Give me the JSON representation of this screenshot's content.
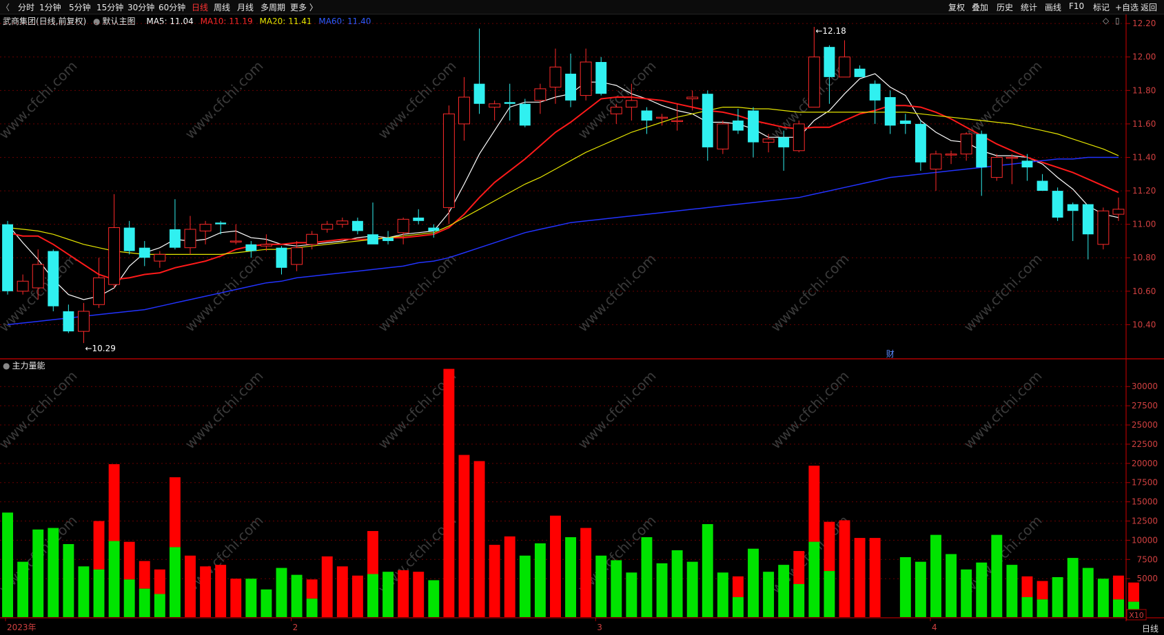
{
  "toolbar": {
    "back_glyph": "〈",
    "periods": [
      "分时",
      "1分钟",
      "5分钟",
      "15分钟",
      "30分钟",
      "60分钟",
      "日线",
      "周线",
      "月线",
      "多周期",
      "更多 〉"
    ],
    "active_period": "日线",
    "right_items": [
      "复权",
      "叠加",
      "历史",
      "统计",
      "画线",
      "F10",
      "标记",
      "+自选",
      "返回"
    ]
  },
  "header": {
    "stock": "武商集团(日线,前复权)",
    "main_chart": "默认主图",
    "ma5": "MA5: 11.04",
    "ma10": "MA10: 11.19",
    "ma20": "MA20: 11.41",
    "ma60": "MA60: 11.40"
  },
  "volume_panel": {
    "title": "主力量能",
    "multiplier": "X10"
  },
  "annotations": {
    "high_label": "12.18",
    "low_label": "10.29",
    "event_marker": "财"
  },
  "x_axis": {
    "labels": [
      "2023年",
      "2",
      "3",
      "4"
    ]
  },
  "period_label": "日线",
  "watermark": "www.cfchi.com",
  "colors": {
    "up": "#ff2a2a",
    "down": "#30f0f0",
    "vol_up": "#ff0000",
    "vol_down": "#00e400",
    "ma5": "#ffffff",
    "ma10": "#ff1a1a",
    "ma20": "#e6e600",
    "ma60": "#2233ff"
  },
  "chart_data": [
    {
      "type": "candlestick",
      "title": "武商集团(日线,前复权)",
      "y_ticks": [
        10.4,
        10.6,
        10.8,
        11.0,
        11.2,
        11.4,
        11.6,
        11.8,
        12.0,
        12.2
      ],
      "ylim": [
        10.2,
        12.25
      ],
      "candles": [
        {
          "o": 11.0,
          "h": 11.02,
          "l": 10.58,
          "c": 10.6
        },
        {
          "o": 10.6,
          "h": 10.7,
          "l": 10.58,
          "c": 10.66
        },
        {
          "o": 10.62,
          "h": 10.85,
          "l": 10.55,
          "c": 10.76
        },
        {
          "o": 10.84,
          "h": 10.85,
          "l": 10.48,
          "c": 10.51
        },
        {
          "o": 10.48,
          "h": 10.52,
          "l": 10.35,
          "c": 10.36
        },
        {
          "o": 10.36,
          "h": 10.53,
          "l": 10.29,
          "c": 10.48
        },
        {
          "o": 10.52,
          "h": 10.8,
          "l": 10.5,
          "c": 10.68
        },
        {
          "o": 10.64,
          "h": 11.18,
          "l": 10.62,
          "c": 10.98
        },
        {
          "o": 10.98,
          "h": 11.02,
          "l": 10.82,
          "c": 10.84
        },
        {
          "o": 10.86,
          "h": 10.9,
          "l": 10.75,
          "c": 10.8
        },
        {
          "o": 10.78,
          "h": 10.84,
          "l": 10.74,
          "c": 10.82
        },
        {
          "o": 10.97,
          "h": 11.15,
          "l": 10.85,
          "c": 10.86
        },
        {
          "o": 10.86,
          "h": 11.05,
          "l": 10.82,
          "c": 10.97
        },
        {
          "o": 10.96,
          "h": 11.02,
          "l": 10.88,
          "c": 11.0
        },
        {
          "o": 11.01,
          "h": 11.02,
          "l": 10.94,
          "c": 11.0
        },
        {
          "o": 10.9,
          "h": 11.0,
          "l": 10.88,
          "c": 10.9
        },
        {
          "o": 10.88,
          "h": 10.9,
          "l": 10.8,
          "c": 10.84
        },
        {
          "o": 10.87,
          "h": 10.94,
          "l": 10.84,
          "c": 10.88
        },
        {
          "o": 10.86,
          "h": 10.87,
          "l": 10.7,
          "c": 10.74
        },
        {
          "o": 10.76,
          "h": 10.9,
          "l": 10.72,
          "c": 10.86
        },
        {
          "o": 10.88,
          "h": 10.96,
          "l": 10.85,
          "c": 10.94
        },
        {
          "o": 10.97,
          "h": 11.02,
          "l": 10.95,
          "c": 11.0
        },
        {
          "o": 11.0,
          "h": 11.04,
          "l": 10.98,
          "c": 11.02
        },
        {
          "o": 11.02,
          "h": 11.04,
          "l": 10.94,
          "c": 10.96
        },
        {
          "o": 10.94,
          "h": 11.13,
          "l": 10.9,
          "c": 10.88
        },
        {
          "o": 10.92,
          "h": 10.96,
          "l": 10.88,
          "c": 10.9
        },
        {
          "o": 10.95,
          "h": 11.04,
          "l": 10.88,
          "c": 11.03
        },
        {
          "o": 11.04,
          "h": 11.09,
          "l": 11.0,
          "c": 11.02
        },
        {
          "o": 10.98,
          "h": 11.0,
          "l": 10.92,
          "c": 10.96
        },
        {
          "o": 11.1,
          "h": 11.71,
          "l": 11.0,
          "c": 11.66
        },
        {
          "o": 11.6,
          "h": 11.88,
          "l": 11.5,
          "c": 11.76
        },
        {
          "o": 11.84,
          "h": 12.17,
          "l": 11.66,
          "c": 11.72
        },
        {
          "o": 11.7,
          "h": 11.74,
          "l": 11.62,
          "c": 11.72
        },
        {
          "o": 11.73,
          "h": 11.84,
          "l": 11.62,
          "c": 11.72
        },
        {
          "o": 11.72,
          "h": 11.75,
          "l": 11.58,
          "c": 11.59
        },
        {
          "o": 11.74,
          "h": 11.84,
          "l": 11.66,
          "c": 11.81
        },
        {
          "o": 11.82,
          "h": 12.05,
          "l": 11.72,
          "c": 11.94
        },
        {
          "o": 11.9,
          "h": 12.02,
          "l": 11.7,
          "c": 11.74
        },
        {
          "o": 11.77,
          "h": 12.05,
          "l": 11.74,
          "c": 11.97
        },
        {
          "o": 11.97,
          "h": 12.0,
          "l": 11.77,
          "c": 11.78
        },
        {
          "o": 11.66,
          "h": 11.72,
          "l": 11.6,
          "c": 11.7
        },
        {
          "o": 11.7,
          "h": 11.84,
          "l": 11.62,
          "c": 11.74
        },
        {
          "o": 11.68,
          "h": 11.7,
          "l": 11.54,
          "c": 11.62
        },
        {
          "o": 11.64,
          "h": 11.66,
          "l": 11.59,
          "c": 11.64
        },
        {
          "o": 11.62,
          "h": 11.72,
          "l": 11.56,
          "c": 11.62
        },
        {
          "o": 11.75,
          "h": 11.8,
          "l": 11.68,
          "c": 11.76
        },
        {
          "o": 11.78,
          "h": 11.8,
          "l": 11.38,
          "c": 11.46
        },
        {
          "o": 11.45,
          "h": 11.62,
          "l": 11.42,
          "c": 11.6
        },
        {
          "o": 11.62,
          "h": 11.69,
          "l": 11.54,
          "c": 11.56
        },
        {
          "o": 11.68,
          "h": 11.7,
          "l": 11.4,
          "c": 11.49
        },
        {
          "o": 11.49,
          "h": 11.54,
          "l": 11.43,
          "c": 11.51
        },
        {
          "o": 11.52,
          "h": 11.56,
          "l": 11.32,
          "c": 11.46
        },
        {
          "o": 11.44,
          "h": 11.62,
          "l": 11.43,
          "c": 11.6
        },
        {
          "o": 11.7,
          "h": 12.18,
          "l": 11.7,
          "c": 12.0
        },
        {
          "o": 12.06,
          "h": 12.07,
          "l": 11.72,
          "c": 11.88
        },
        {
          "o": 11.88,
          "h": 12.1,
          "l": 11.88,
          "c": 12.0
        },
        {
          "o": 11.93,
          "h": 11.95,
          "l": 11.88,
          "c": 11.88
        },
        {
          "o": 11.84,
          "h": 11.86,
          "l": 11.6,
          "c": 11.74
        },
        {
          "o": 11.76,
          "h": 11.8,
          "l": 11.54,
          "c": 11.59
        },
        {
          "o": 11.62,
          "h": 11.66,
          "l": 11.54,
          "c": 11.6
        },
        {
          "o": 11.6,
          "h": 11.62,
          "l": 11.32,
          "c": 11.37
        },
        {
          "o": 11.33,
          "h": 11.44,
          "l": 11.2,
          "c": 11.42
        },
        {
          "o": 11.42,
          "h": 11.44,
          "l": 11.36,
          "c": 11.42
        },
        {
          "o": 11.42,
          "h": 11.55,
          "l": 11.38,
          "c": 11.54
        },
        {
          "o": 11.54,
          "h": 11.56,
          "l": 11.17,
          "c": 11.34
        },
        {
          "o": 11.28,
          "h": 11.42,
          "l": 11.26,
          "c": 11.4
        },
        {
          "o": 11.4,
          "h": 11.42,
          "l": 11.24,
          "c": 11.4
        },
        {
          "o": 11.38,
          "h": 11.42,
          "l": 11.26,
          "c": 11.34
        },
        {
          "o": 11.26,
          "h": 11.3,
          "l": 11.2,
          "c": 11.2
        },
        {
          "o": 11.2,
          "h": 11.22,
          "l": 11.02,
          "c": 11.04
        },
        {
          "o": 11.12,
          "h": 11.13,
          "l": 10.9,
          "c": 11.08
        },
        {
          "o": 11.12,
          "h": 11.12,
          "l": 10.79,
          "c": 10.94
        },
        {
          "o": 10.88,
          "h": 11.1,
          "l": 10.85,
          "c": 11.08
        },
        {
          "o": 11.06,
          "h": 11.16,
          "l": 11.02,
          "c": 11.09
        }
      ],
      "ma_series": [
        {
          "name": "MA5",
          "values": [
            11.0,
            10.89,
            10.79,
            10.67,
            10.58,
            10.55,
            10.57,
            10.62,
            10.75,
            10.83,
            10.86,
            10.91,
            10.9,
            10.91,
            10.95,
            10.96,
            10.92,
            10.91,
            10.88,
            10.87,
            10.88,
            10.89,
            10.9,
            10.92,
            10.93,
            10.92,
            10.94,
            10.95,
            10.96,
            11.07,
            11.24,
            11.42,
            11.56,
            11.7,
            11.73,
            11.73,
            11.76,
            11.78,
            11.85,
            11.85,
            11.83,
            11.78,
            11.75,
            11.71,
            11.68,
            11.66,
            11.61,
            11.61,
            11.6,
            11.57,
            11.52,
            11.52,
            11.52,
            11.62,
            11.68,
            11.78,
            11.87,
            11.9,
            11.82,
            11.77,
            11.62,
            11.55,
            11.5,
            11.49,
            11.44,
            11.41,
            11.41,
            11.4,
            11.36,
            11.28,
            11.21,
            11.11,
            11.06,
            11.04
          ]
        },
        {
          "name": "MA10",
          "values": [
            10.95,
            10.93,
            10.93,
            10.88,
            10.82,
            10.76,
            10.7,
            10.67,
            10.68,
            10.7,
            10.71,
            10.74,
            10.76,
            10.78,
            10.81,
            10.85,
            10.87,
            10.88,
            10.88,
            10.89,
            10.89,
            10.9,
            10.91,
            10.91,
            10.91,
            10.92,
            10.92,
            10.93,
            10.94,
            10.98,
            11.06,
            11.16,
            11.25,
            11.32,
            11.39,
            11.47,
            11.55,
            11.61,
            11.68,
            11.75,
            11.76,
            11.76,
            11.75,
            11.74,
            11.72,
            11.7,
            11.68,
            11.67,
            11.65,
            11.62,
            11.6,
            11.58,
            11.57,
            11.58,
            11.58,
            11.62,
            11.66,
            11.68,
            11.71,
            11.71,
            11.7,
            11.67,
            11.63,
            11.58,
            11.53,
            11.48,
            11.44,
            11.4,
            11.37,
            11.34,
            11.31,
            11.27,
            11.23,
            11.19
          ]
        },
        {
          "name": "MA20",
          "values": [
            10.98,
            10.97,
            10.96,
            10.94,
            10.91,
            10.88,
            10.86,
            10.84,
            10.83,
            10.82,
            10.82,
            10.82,
            10.82,
            10.82,
            10.82,
            10.83,
            10.84,
            10.85,
            10.85,
            10.86,
            10.87,
            10.88,
            10.89,
            10.9,
            10.91,
            10.92,
            10.93,
            10.94,
            10.95,
            10.99,
            11.04,
            11.09,
            11.14,
            11.19,
            11.24,
            11.28,
            11.33,
            11.38,
            11.43,
            11.47,
            11.51,
            11.55,
            11.58,
            11.61,
            11.64,
            11.66,
            11.68,
            11.7,
            11.7,
            11.69,
            11.69,
            11.68,
            11.67,
            11.67,
            11.67,
            11.67,
            11.67,
            11.67,
            11.67,
            11.67,
            11.66,
            11.65,
            11.64,
            11.63,
            11.62,
            11.61,
            11.6,
            11.58,
            11.56,
            11.54,
            11.51,
            11.48,
            11.45,
            11.41
          ]
        },
        {
          "name": "MA60",
          "values": [
            10.4,
            10.41,
            10.42,
            10.43,
            10.44,
            10.45,
            10.46,
            10.47,
            10.48,
            10.49,
            10.51,
            10.53,
            10.55,
            10.57,
            10.59,
            10.61,
            10.63,
            10.65,
            10.66,
            10.68,
            10.69,
            10.7,
            10.71,
            10.72,
            10.73,
            10.74,
            10.75,
            10.77,
            10.78,
            10.8,
            10.83,
            10.86,
            10.89,
            10.92,
            10.95,
            10.97,
            10.99,
            11.01,
            11.02,
            11.03,
            11.04,
            11.05,
            11.06,
            11.07,
            11.08,
            11.09,
            11.1,
            11.11,
            11.12,
            11.13,
            11.14,
            11.15,
            11.16,
            11.18,
            11.2,
            11.22,
            11.24,
            11.26,
            11.28,
            11.29,
            11.3,
            11.31,
            11.32,
            11.33,
            11.34,
            11.35,
            11.36,
            11.37,
            11.38,
            11.39,
            11.39,
            11.4,
            11.4,
            11.4
          ]
        }
      ]
    },
    {
      "type": "bar",
      "title": "主力量能",
      "y_ticks": [
        5000,
        7500,
        10000,
        12500,
        15000,
        17500,
        20000,
        22500,
        25000,
        27500,
        30000
      ],
      "ylim": [
        0,
        32800
      ],
      "stacked_series": [
        {
          "name": "green",
          "values": [
            13600,
            7200,
            11400,
            11600,
            9500,
            6600,
            6200,
            9900,
            4900,
            3700,
            3000,
            9100,
            0,
            0,
            0,
            0,
            5000,
            3600,
            6400,
            5500,
            2400,
            0,
            0,
            0,
            5600,
            5900,
            0,
            0,
            4800,
            0,
            0,
            0,
            0,
            0,
            8000,
            9600,
            0,
            10400,
            0,
            8000,
            7400,
            5800,
            10400,
            7000,
            8700,
            7200,
            12100,
            5800,
            2600,
            8900,
            5900,
            6800,
            4300,
            9800,
            6000,
            0,
            0,
            0,
            0,
            7800,
            7200,
            10700,
            8200,
            6200,
            7100,
            10700,
            6800,
            2600,
            2300,
            5200,
            7700,
            6400,
            5000,
            2300,
            2000
          ]
        },
        {
          "name": "red",
          "values": [
            0,
            0,
            0,
            0,
            0,
            0,
            6200,
            0,
            4900,
            3700,
            3000,
            0,
            0,
            0,
            0,
            0,
            0,
            0,
            0,
            0,
            0,
            0,
            0,
            0,
            0,
            0,
            0,
            0,
            0,
            0,
            0,
            0,
            0,
            0,
            3700,
            4500,
            0,
            0,
            0,
            0,
            0,
            0,
            0,
            0,
            0,
            0,
            0,
            0,
            0,
            0,
            0,
            0,
            0,
            0,
            0,
            0,
            0,
            0,
            0,
            0,
            0,
            0,
            0,
            0,
            0,
            0,
            0,
            0,
            0,
            0,
            0,
            0,
            0,
            0,
            0
          ]
        },
        {
          "name": "vol_total",
          "values": [
            13600,
            7200,
            11400,
            11600,
            9500,
            6600,
            12500,
            19900,
            9800,
            7300,
            6200,
            18200,
            8000,
            6600,
            6800,
            5000,
            5000,
            3600,
            6400,
            5500,
            4900,
            7900,
            6600,
            5400,
            11200,
            5900,
            6100,
            5900,
            4800,
            32300,
            21100,
            20300,
            9400,
            10500,
            8000,
            9600,
            13200,
            10400,
            11600,
            8000,
            7400,
            5800,
            10400,
            7000,
            8700,
            7200,
            12100,
            5800,
            5300,
            8900,
            5900,
            6800,
            8600,
            19700,
            12400,
            12600,
            10300,
            10300,
            0,
            7800,
            7200,
            10700,
            8200,
            6200,
            7100,
            10700,
            6800,
            5300,
            4700,
            5200,
            7700,
            6400,
            5000,
            5400,
            4500
          ]
        }
      ]
    }
  ]
}
